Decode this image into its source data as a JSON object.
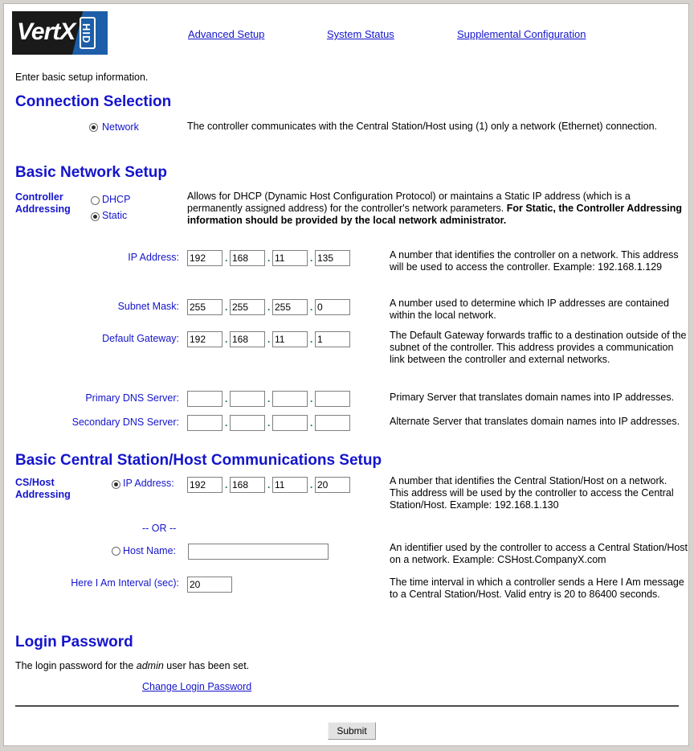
{
  "header": {
    "logo_word": "VertX",
    "logo_badge": "HID",
    "nav": [
      {
        "label": "Advanced Setup"
      },
      {
        "label": "System Status"
      },
      {
        "label": "Supplemental Configuration"
      }
    ]
  },
  "intro": "Enter basic setup information.",
  "connection_selection": {
    "heading": "Connection Selection",
    "option_label": "Network",
    "option_selected": true,
    "description": "The controller communicates with the Central Station/Host using (1) only a network (Ethernet) connection."
  },
  "basic_network_setup": {
    "heading": "Basic Network Setup",
    "controller_addressing_label_line1": "Controller",
    "controller_addressing_label_line2": "Addressing",
    "dhcp_label": "DHCP",
    "static_label": "Static",
    "addressing_desc_normal": "Allows for DHCP (Dynamic Host Configuration Protocol) or maintains a Static IP address (which is a permanently assigned address) for the controller's network parameters.",
    "addressing_desc_bold": "For Static, the Controller Addressing information should be provided by the local network administrator.",
    "rows": [
      {
        "label": "IP Address:",
        "octets": [
          "192",
          "168",
          "11",
          "135"
        ],
        "description": "A number that identifies the controller on a network. This address will be used to access the controller. Example: 192.168.1.129"
      },
      {
        "label": "Subnet Mask:",
        "octets": [
          "255",
          "255",
          "255",
          "0"
        ],
        "description": "A number used to determine which IP addresses are contained within the local network."
      },
      {
        "label": "Default Gateway:",
        "octets": [
          "192",
          "168",
          "11",
          "1"
        ],
        "description": "The Default Gateway forwards traffic to a destination outside of the subnet of the controller. This address provides a communication link between the controller and external networks."
      },
      {
        "label": "Primary DNS Server:",
        "octets": [
          "",
          "",
          "",
          ""
        ],
        "description": "Primary Server that translates domain names into IP addresses."
      },
      {
        "label": "Secondary DNS Server:",
        "octets": [
          "",
          "",
          "",
          ""
        ],
        "description": "Alternate Server that translates domain names into IP addresses."
      }
    ]
  },
  "cs_host_setup": {
    "heading": "Basic Central Station/Host Communications Setup",
    "cs_host_label_line1": "CS/Host",
    "cs_host_label_line2": "Addressing",
    "ip_label": "IP Address:",
    "ip_selected": true,
    "ip_octets": [
      "192",
      "168",
      "11",
      "20"
    ],
    "ip_description": "A number that identifies the Central Station/Host on a network. This address will be used by the controller to access the Central Station/Host. Example: 192.168.1.130",
    "or_text": "-- OR --",
    "host_name_label": "Host Name:",
    "host_name_selected": false,
    "host_name_value": "",
    "host_name_description": "An identifier used by the controller to access a Central Station/Host on a network. Example: CSHost.CompanyX.com",
    "here_i_am_label": "Here I Am Interval (sec):",
    "here_i_am_value": "20",
    "here_i_am_description": "The time interval in which a controller sends a Here I Am message to a Central Station/Host. Valid entry is 20 to 86400 seconds."
  },
  "login_password": {
    "heading": "Login Password",
    "status_prefix": "The login password for the ",
    "status_user": "admin",
    "status_suffix": " user has been set.",
    "change_link": "Change Login Password"
  },
  "footer": {
    "submit_label": "Submit"
  },
  "colors": {
    "link": "#1414CC",
    "heading": "#1414CC",
    "logo_blue": "#1C5EA8",
    "page_bg": "#FFFFFF",
    "outer_bg": "#D6D2CE"
  }
}
